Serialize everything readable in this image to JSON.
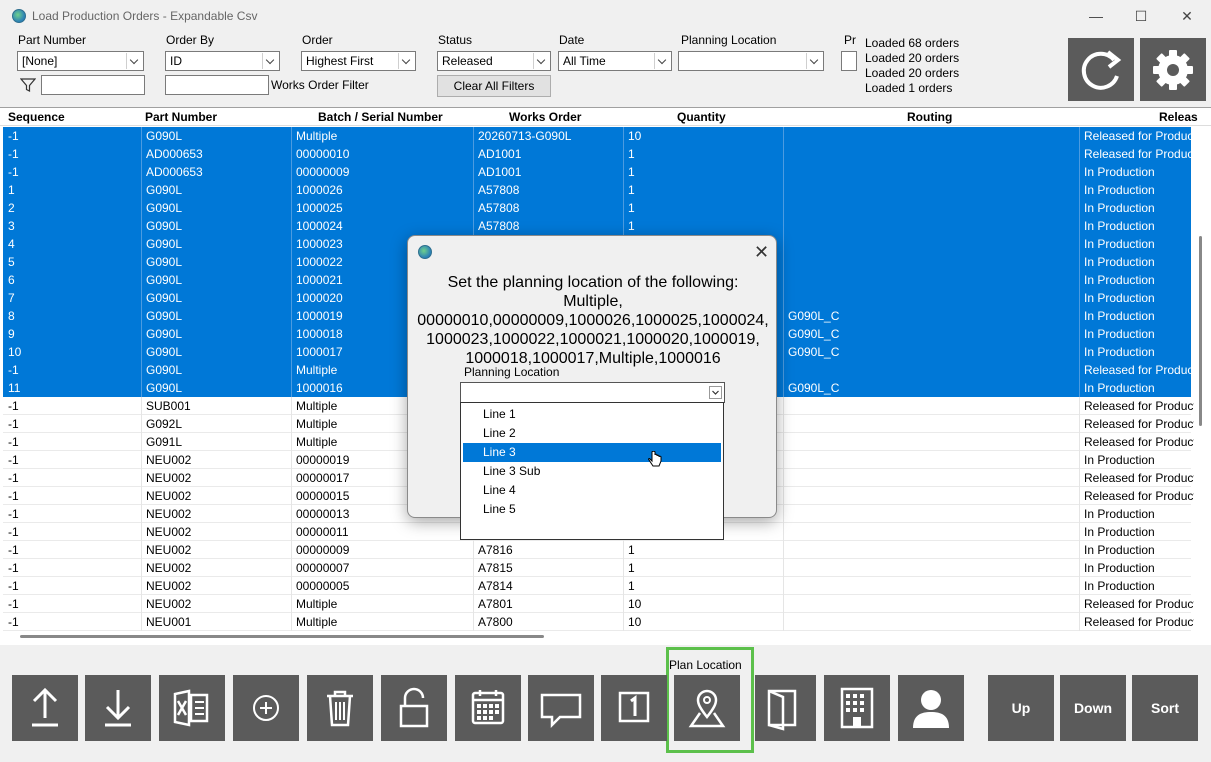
{
  "window": {
    "title": "Load Production Orders - Expandable Csv",
    "minimize": "—",
    "maximize": "☐",
    "close": "✕"
  },
  "filters": {
    "part_number_label": "Part Number",
    "part_number_value": "[None]",
    "order_by_label": "Order By",
    "order_by_value": "ID",
    "order_label": "Order",
    "order_value": "Highest First",
    "status_label": "Status",
    "status_value": "Released",
    "date_label": "Date",
    "date_value": "All Time",
    "planning_location_label": "Planning Location",
    "planning_location_value": "",
    "pr_label": "Pr",
    "works_order_filter_label": "Works Order Filter",
    "clear_all_filters": "Clear All Filters"
  },
  "loaded": [
    "Loaded 68 orders",
    "Loaded 20 orders",
    "Loaded 20 orders",
    "Loaded 1 orders"
  ],
  "grid": {
    "headers": [
      "Sequence",
      "Part Number",
      "Batch / Serial Number",
      "Works Order",
      "Quantity",
      "Routing",
      "Releas"
    ],
    "rows": [
      {
        "selected": true,
        "cells": [
          "-1",
          "G090L",
          "Multiple",
          "20260713-G090L",
          "10",
          "",
          "Released for Product"
        ]
      },
      {
        "selected": true,
        "cells": [
          "-1",
          "AD000653",
          "00000010",
          "AD1001",
          "1",
          "",
          "Released for Product"
        ]
      },
      {
        "selected": true,
        "cells": [
          "-1",
          "AD000653",
          "00000009",
          "AD1001",
          "1",
          "",
          "In Production"
        ]
      },
      {
        "selected": true,
        "cells": [
          "1",
          "G090L",
          "1000026",
          "A57808",
          "1",
          "",
          "In Production"
        ]
      },
      {
        "selected": true,
        "cells": [
          "2",
          "G090L",
          "1000025",
          "A57808",
          "1",
          "",
          "In Production"
        ]
      },
      {
        "selected": true,
        "cells": [
          "3",
          "G090L",
          "1000024",
          "A57808",
          "1",
          "",
          "In Production"
        ]
      },
      {
        "selected": true,
        "cells": [
          "4",
          "G090L",
          "1000023",
          "",
          "",
          "",
          "In Production"
        ]
      },
      {
        "selected": true,
        "cells": [
          "5",
          "G090L",
          "1000022",
          "",
          "",
          "",
          "In Production"
        ]
      },
      {
        "selected": true,
        "cells": [
          "6",
          "G090L",
          "1000021",
          "",
          "",
          "",
          "In Production"
        ]
      },
      {
        "selected": true,
        "cells": [
          "7",
          "G090L",
          "1000020",
          "",
          "",
          "",
          "In Production"
        ]
      },
      {
        "selected": true,
        "cells": [
          "8",
          "G090L",
          "1000019",
          "",
          "",
          "G090L_C",
          "In Production"
        ]
      },
      {
        "selected": true,
        "cells": [
          "9",
          "G090L",
          "1000018",
          "",
          "",
          "G090L_C",
          "In Production"
        ]
      },
      {
        "selected": true,
        "cells": [
          "10",
          "G090L",
          "1000017",
          "",
          "",
          "G090L_C",
          "In Production"
        ]
      },
      {
        "selected": true,
        "cells": [
          "-1",
          "G090L",
          "Multiple",
          "",
          "",
          "",
          "Released for Product"
        ]
      },
      {
        "selected": true,
        "cells": [
          "11",
          "G090L",
          "1000016",
          "",
          "",
          "G090L_C",
          "In Production"
        ]
      },
      {
        "selected": false,
        "cells": [
          "-1",
          "SUB001",
          "Multiple",
          "",
          "",
          "",
          "Released for Product"
        ]
      },
      {
        "selected": false,
        "cells": [
          "-1",
          "G092L",
          "Multiple",
          "",
          "",
          "",
          "Released for Product"
        ]
      },
      {
        "selected": false,
        "cells": [
          "-1",
          "G091L",
          "Multiple",
          "",
          "",
          "",
          "Released for Product"
        ]
      },
      {
        "selected": false,
        "cells": [
          "-1",
          "NEU002",
          "00000019",
          "",
          "",
          "",
          "In Production"
        ]
      },
      {
        "selected": false,
        "cells": [
          "-1",
          "NEU002",
          "00000017",
          "",
          "",
          "",
          "Released for Product"
        ]
      },
      {
        "selected": false,
        "cells": [
          "-1",
          "NEU002",
          "00000015",
          "",
          "",
          "",
          "Released for Product"
        ]
      },
      {
        "selected": false,
        "cells": [
          "-1",
          "NEU002",
          "00000013",
          "",
          "",
          "",
          "In Production"
        ]
      },
      {
        "selected": false,
        "cells": [
          "-1",
          "NEU002",
          "00000011",
          "",
          "",
          "",
          "In Production"
        ]
      },
      {
        "selected": false,
        "cells": [
          "-1",
          "NEU002",
          "00000009",
          "A7816",
          "1",
          "",
          "In Production"
        ]
      },
      {
        "selected": false,
        "cells": [
          "-1",
          "NEU002",
          "00000007",
          "A7815",
          "1",
          "",
          "In Production"
        ]
      },
      {
        "selected": false,
        "cells": [
          "-1",
          "NEU002",
          "00000005",
          "A7814",
          "1",
          "",
          "In Production"
        ]
      },
      {
        "selected": false,
        "cells": [
          "-1",
          "NEU002",
          "Multiple",
          "A7801",
          "10",
          "",
          "Released for Product"
        ]
      },
      {
        "selected": false,
        "cells": [
          "-1",
          "NEU001",
          "Multiple",
          "A7800",
          "10",
          "",
          "Released for Product"
        ]
      }
    ]
  },
  "dialog": {
    "message": "Set the planning location of the following: Multiple, 00000010,00000009,1000026,1000025,1000024, 1000023,1000022,1000021,1000020,1000019, 1000018,1000017,Multiple,1000016",
    "close": "✕",
    "planning_location_label": "Planning Location",
    "planning_location_value": "",
    "options": [
      "Line 1",
      "Line 2",
      "Line 3",
      "Line 3 Sub",
      "Line 4",
      "Line 5"
    ],
    "highlighted": "Line 3"
  },
  "toolbar": {
    "plan_location_label": "Plan Location",
    "up": "Up",
    "down": "Down",
    "sort": "Sort",
    "icons": [
      "upload-icon",
      "download-icon",
      "excel-icon",
      "add-icon",
      "delete-icon",
      "unlock-icon",
      "calendar-icon",
      "comment-icon",
      "one-icon",
      "map-pin-icon",
      "door-icon",
      "building-icon",
      "user-icon"
    ]
  },
  "colors": {
    "selection": "#0078d7",
    "button_bg": "#5b5b5b",
    "highlight_border": "#5cc04b"
  }
}
